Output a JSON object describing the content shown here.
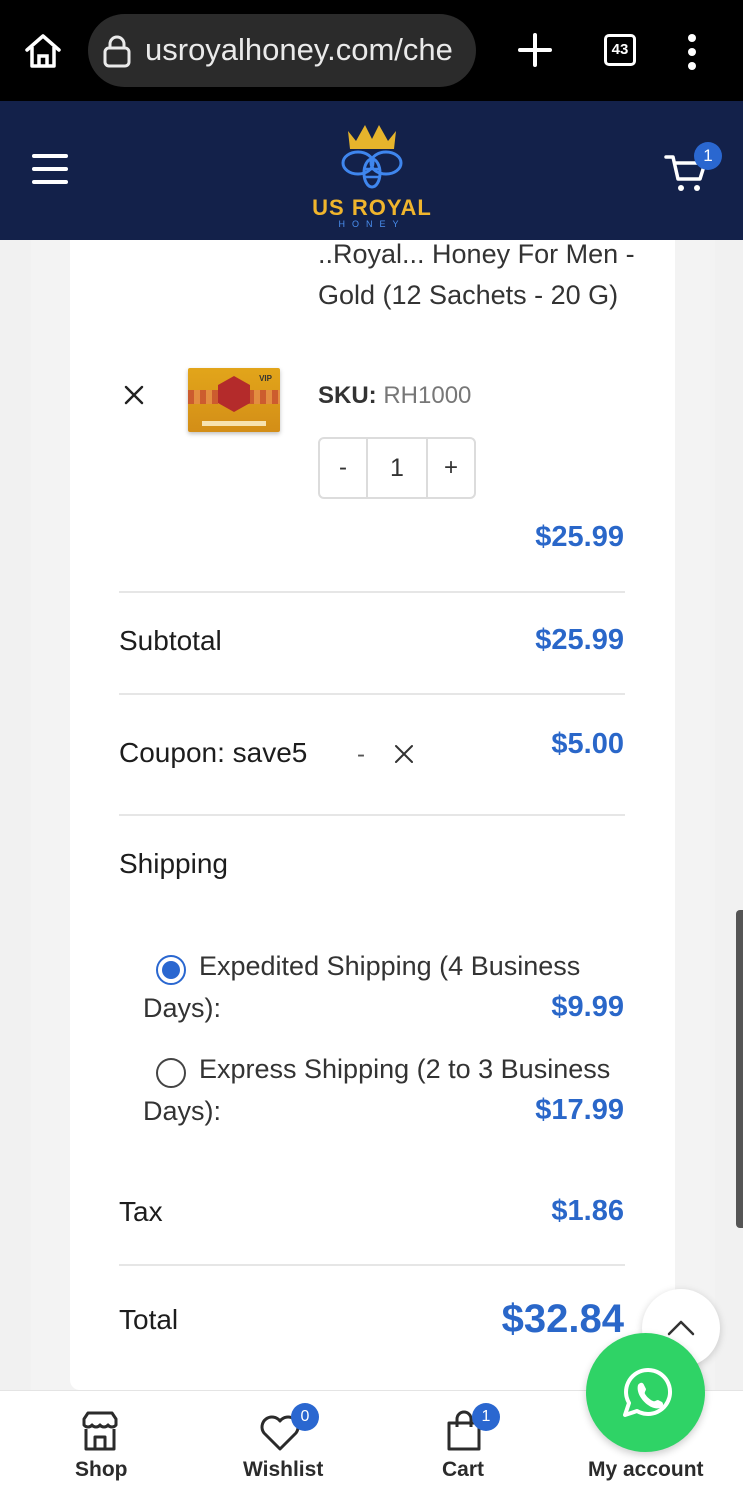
{
  "browser": {
    "url": "usroyalhoney.com/che",
    "tab_count": "43"
  },
  "header": {
    "logo_text": "US ROYAL",
    "logo_sub": "HONEY",
    "cart_count": "1",
    "brand_color": "#13214a",
    "accent_color": "#2a67c9"
  },
  "product": {
    "name": "..Royal... Honey For Men - Gold (12 Sachets - 20 G)",
    "sku_label": "SKU:",
    "sku": "RH1000",
    "qty_minus": "-",
    "qty_value": "1",
    "qty_plus": "+",
    "price": "$25.99"
  },
  "totals": {
    "subtotal_label": "Subtotal",
    "subtotal_value": "$25.99",
    "coupon_label": "Coupon: save5",
    "coupon_dash": "-",
    "coupon_value": "$5.00",
    "shipping_label": "Shipping",
    "shipping_options": [
      {
        "label_line1": "Expedited Shipping (4 Business",
        "label_line2": "Days):",
        "price": "$9.99",
        "selected": true
      },
      {
        "label_line1": "Express Shipping (2 to 3 Business",
        "label_line2": "Days):",
        "price": "$17.99",
        "selected": false
      }
    ],
    "tax_label": "Tax",
    "tax_value": "$1.86",
    "total_label": "Total",
    "total_value": "$32.84"
  },
  "bottom_nav": {
    "shop": "Shop",
    "wishlist": "Wishlist",
    "wishlist_count": "0",
    "cart": "Cart",
    "cart_count": "1",
    "account": "My account"
  },
  "icons": {
    "home": "home-icon",
    "lock": "lock-icon",
    "new_tab": "plus-icon",
    "tabs": "tab-switcher-icon",
    "menu": "kebab-menu-icon",
    "hamburger": "hamburger-icon",
    "cart": "cart-icon",
    "remove": "close-icon",
    "scroll_top": "chevron-up-icon",
    "whatsapp": "whatsapp-icon"
  }
}
